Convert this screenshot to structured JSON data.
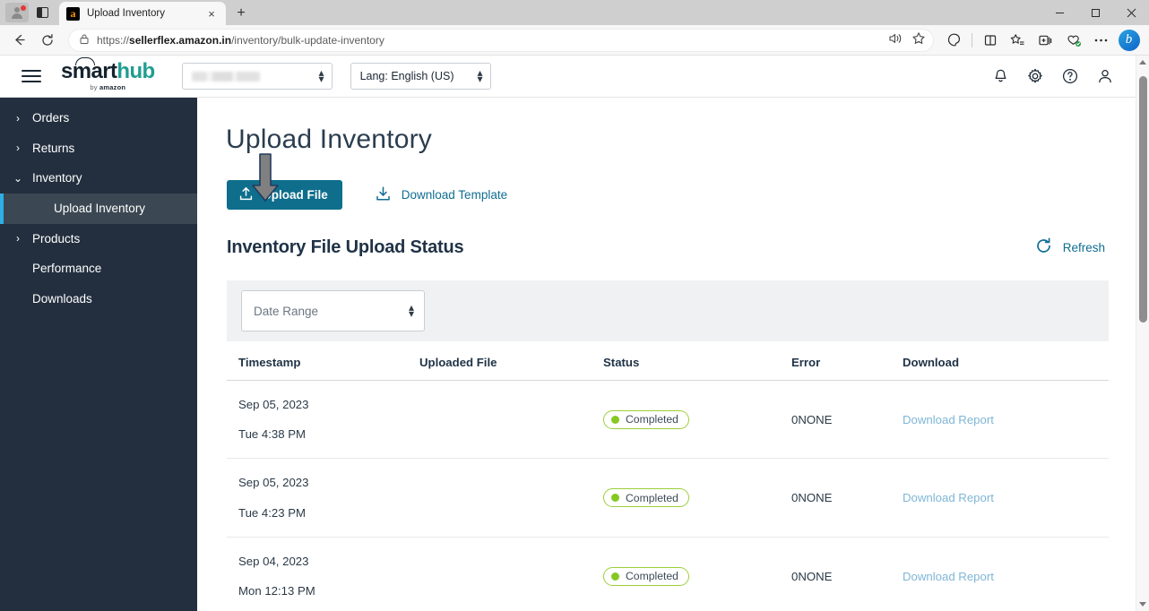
{
  "browser": {
    "tab": {
      "title": "Upload Inventory",
      "favicon": "amazon-icon",
      "close": "×"
    },
    "new_tab_label": "+",
    "window_controls": {
      "minimize": "minimize-icon",
      "maximize": "maximize-icon",
      "close": "close-icon"
    },
    "nav": {
      "back": "back-arrow-icon",
      "reload": "reload-icon"
    },
    "omnibox": {
      "lock": "lock-icon",
      "url_prefix": "https://",
      "url_domain": "sellerflex.amazon.in",
      "url_path": "/inventory/bulk-update-inventory",
      "read_aloud": "read-aloud-icon",
      "favorite": "star-icon"
    },
    "toolbar_icons": [
      "split-screen-icon",
      "collections-icon",
      "browser-essentials-icon",
      "settings-more-icon"
    ],
    "profile": {
      "avatar": "profile-avatar-icon",
      "notification": "notification-dot"
    },
    "bing_label": "b"
  },
  "app_header": {
    "menu_icon": "hamburger-menu-icon",
    "logo": {
      "smart": "sm",
      "a": "a",
      "rt": "rt",
      "hub": "hub",
      "by": "by ",
      "amazon": "amazon"
    },
    "node_select": {
      "value": "",
      "placeholder": ""
    },
    "lang_select": {
      "value": "Lang: English (US)"
    },
    "icons": [
      "notification-bell-icon",
      "settings-gear-icon",
      "help-icon",
      "user-account-icon"
    ]
  },
  "sidebar": {
    "items": [
      {
        "label": "Orders",
        "expandable": true,
        "expanded": false,
        "selected": false
      },
      {
        "label": "Returns",
        "expandable": true,
        "expanded": false,
        "selected": false
      },
      {
        "label": "Inventory",
        "expandable": true,
        "expanded": true,
        "selected": false
      },
      {
        "label": "Upload Inventory",
        "expandable": false,
        "expanded": false,
        "selected": true
      },
      {
        "label": "Products",
        "expandable": true,
        "expanded": false,
        "selected": false
      },
      {
        "label": "Performance",
        "expandable": false,
        "expanded": false,
        "selected": false
      },
      {
        "label": "Downloads",
        "expandable": false,
        "expanded": false,
        "selected": false
      }
    ]
  },
  "main": {
    "page_title": "Upload Inventory",
    "upload_button": {
      "label": "Upload File",
      "icon": "upload-icon"
    },
    "download_template": {
      "label": "Download Template",
      "icon": "download-icon"
    },
    "annotation_arrow": "down-arrow-annotation",
    "section_title": "Inventory File Upload Status",
    "refresh": {
      "label": "Refresh",
      "icon": "refresh-icon"
    },
    "date_range": {
      "placeholder": "Date Range"
    },
    "table": {
      "columns": [
        "Timestamp",
        "Uploaded File",
        "Status",
        "Error",
        "Download"
      ],
      "rows": [
        {
          "date": "Sep 05, 2023",
          "time": "Tue 4:38 PM",
          "uploaded_file": "",
          "status": "Completed",
          "status_color": "#86c823",
          "error": "0NONE",
          "download": "Download Report"
        },
        {
          "date": "Sep 05, 2023",
          "time": "Tue 4:23 PM",
          "uploaded_file": "",
          "status": "Completed",
          "status_color": "#86c823",
          "error": "0NONE",
          "download": "Download Report"
        },
        {
          "date": "Sep 04, 2023",
          "time": "Mon 12:13 PM",
          "uploaded_file": "",
          "status": "Completed",
          "status_color": "#86c823",
          "error": "0NONE",
          "download": "Download Report"
        }
      ]
    }
  },
  "colors": {
    "primary": "#0e6e8c",
    "link": "#0f6d92",
    "sidebar_bg": "#232f3e",
    "sidebar_selected_bg": "#3b4752",
    "sidebar_accent": "#2dafe8",
    "badge_green": "#86c823",
    "logo_teal": "#1f9e8f"
  }
}
